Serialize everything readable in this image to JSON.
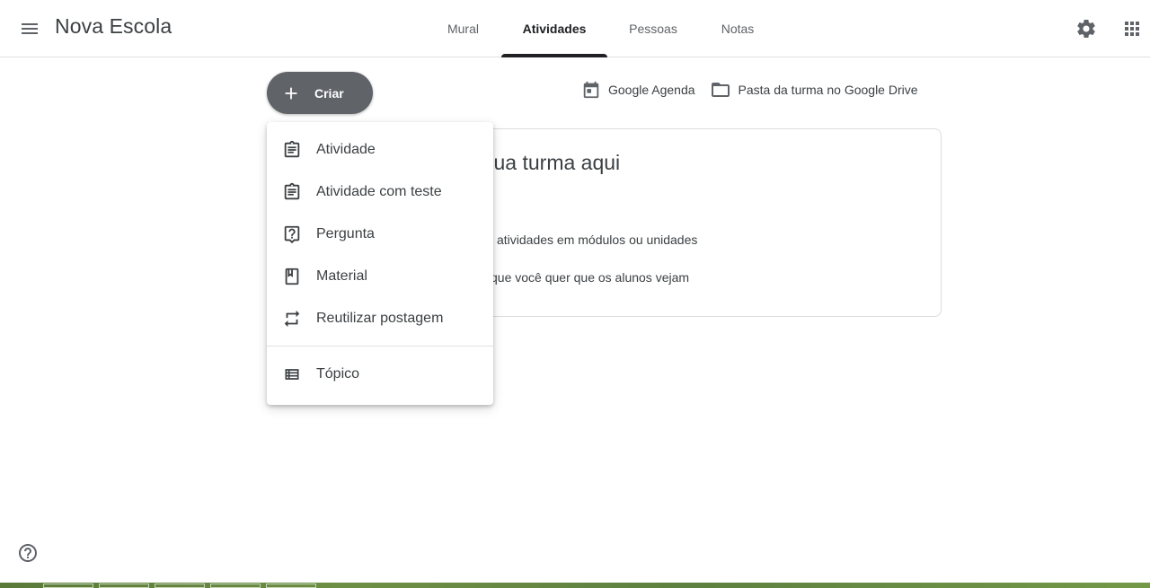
{
  "header": {
    "app_title": "Nova Escola",
    "tabs": [
      {
        "label": "Mural"
      },
      {
        "label": "Atividades"
      },
      {
        "label": "Pessoas"
      },
      {
        "label": "Notas"
      }
    ],
    "active_tab": "Atividades"
  },
  "toolbar": {
    "create_label": "Criar",
    "calendar_label": "Google Agenda",
    "drive_label": "Pasta da turma no Google Drive"
  },
  "card": {
    "title_fragment": "sua turma aqui",
    "line1_fragment": "atividades em módulos ou unidades",
    "line2_fragment": "que você quer que os alunos vejam"
  },
  "create_menu": {
    "items": [
      {
        "label": "Atividade",
        "icon": "assignment-icon"
      },
      {
        "label": "Atividade com teste",
        "icon": "quiz-assignment-icon"
      },
      {
        "label": "Pergunta",
        "icon": "question-icon"
      },
      {
        "label": "Material",
        "icon": "book-icon"
      },
      {
        "label": "Reutilizar postagem",
        "icon": "repeat-icon"
      },
      {
        "label": "Tópico",
        "icon": "topic-list-icon"
      }
    ]
  },
  "colors": {
    "create_button_bg": "#606368",
    "text": "#3c4043",
    "active_tab": "#202124"
  }
}
